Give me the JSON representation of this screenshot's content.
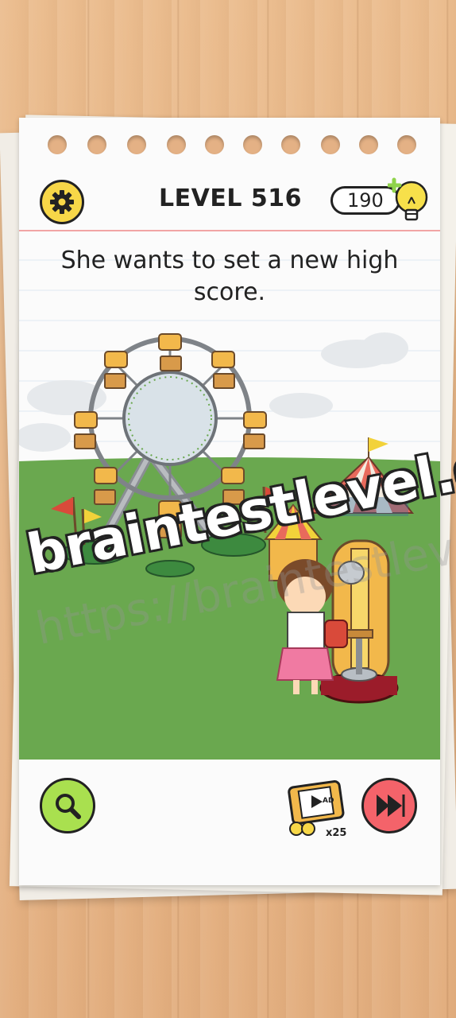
{
  "header": {
    "level_label": "LEVEL 516",
    "coin_count": "190",
    "settings_icon": "gear-icon",
    "hint_bulb_icon": "lightbulb-plus-icon"
  },
  "puzzle": {
    "question_line1": "She wants to set a new high",
    "question_line2": "score."
  },
  "watermark": {
    "main": "braintestlevel.org",
    "faint": "https://braintestleve"
  },
  "footer": {
    "hint_icon": "magnifier-icon",
    "ad_icon": "video-ad-icon",
    "ad_badge": "AD",
    "ad_reward": "x25",
    "skip_icon": "fast-forward-icon"
  },
  "colors": {
    "accent_yellow": "#f7d748",
    "hint_green": "#a9e04f",
    "skip_red": "#f4636a",
    "grass": "#6aa84f"
  }
}
